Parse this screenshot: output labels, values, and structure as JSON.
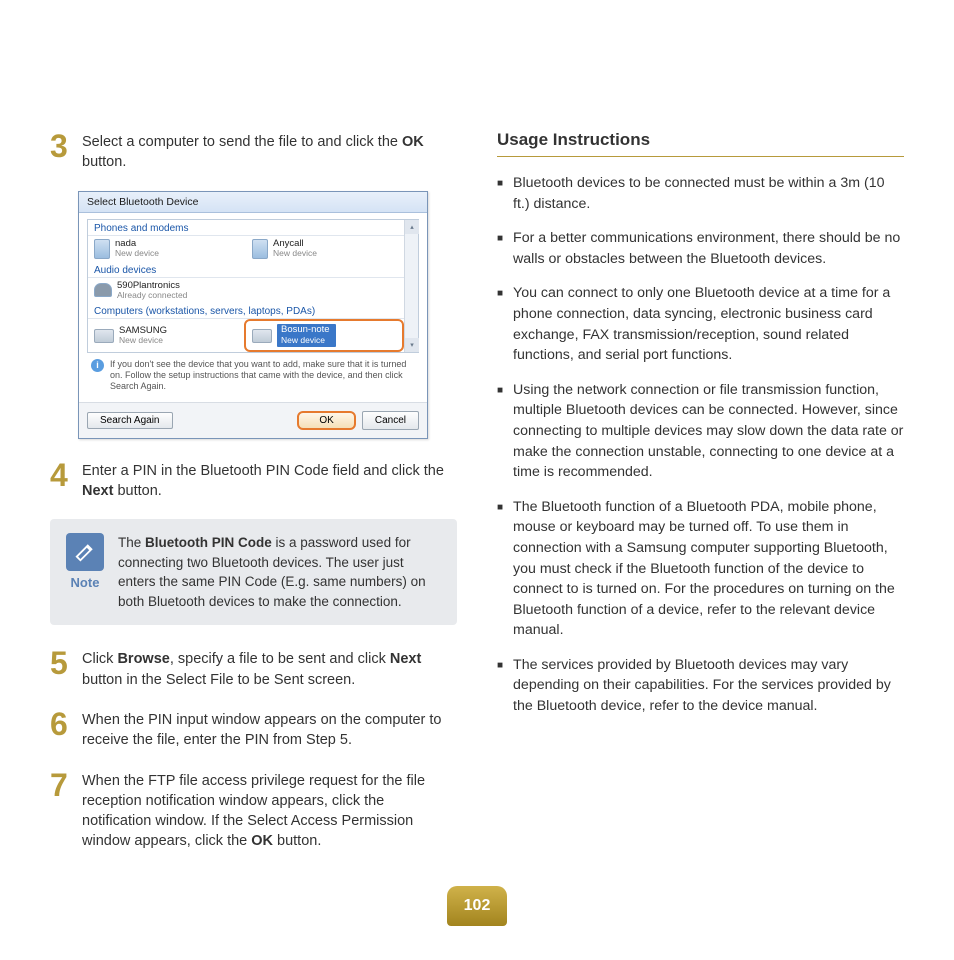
{
  "page_number": "102",
  "left": {
    "steps": [
      {
        "n": "3",
        "pre": "Select a computer to send the file to and click the ",
        "bold": "OK",
        "post": " button."
      },
      {
        "n": "4",
        "pre": "Enter a PIN in the Bluetooth PIN Code field and click the ",
        "bold": "Next",
        "post": " button."
      },
      {
        "n": "5",
        "pre": "Click ",
        "bold": "Browse",
        "mid": ", specify a file to be sent and click ",
        "bold2": "Next",
        "post": " button in the Select File to be Sent screen."
      },
      {
        "n": "6",
        "pre": "When the PIN input window appears on the computer to receive the file, enter the PIN from Step 5.",
        "bold": "",
        "post": ""
      },
      {
        "n": "7",
        "pre": "When the FTP file access privilege request for the file reception notification window appears, click the notification window. If the Select Access Permission window appears, click the ",
        "bold": "OK",
        "post": " button."
      }
    ],
    "note": {
      "label": "Note",
      "pre": "The ",
      "bold": "Bluetooth PIN Code",
      "post": " is a password used for connecting two Bluetooth devices. The user just enters the same PIN Code (E.g. same numbers) on both Bluetooth devices to make the connection."
    },
    "dialog": {
      "title": "Select Bluetooth Device",
      "cat_phones": "Phones and modems",
      "dev_nada": {
        "name": "nada",
        "sub": "New device"
      },
      "dev_anycall": {
        "name": "Anycall",
        "sub": "New device"
      },
      "cat_audio": "Audio devices",
      "dev_plan": {
        "name": "590Plantronics",
        "sub": "Already connected"
      },
      "cat_comp": "Computers (workstations, servers, laptops, PDAs)",
      "dev_samsung": {
        "name": "SAMSUNG",
        "sub": "New device"
      },
      "dev_bosun": {
        "name": "Bosun-note",
        "sub": "New device"
      },
      "info": "If you don't see the device that you want to add, make sure that it is turned on. Follow the setup instructions that came with the device, and then click Search Again.",
      "btn_search": "Search Again",
      "btn_ok": "OK",
      "btn_cancel": "Cancel"
    }
  },
  "right": {
    "title": "Usage Instructions",
    "bullets": [
      "Bluetooth devices to be connected must be within a 3m (10 ft.) distance.",
      "For a better communications environment, there should be no walls or obstacles between the Bluetooth devices.",
      "You can connect to only one Bluetooth device at a time for a phone connection, data syncing, electronic business card exchange, FAX transmission/reception, sound related functions, and serial port functions.",
      "Using the network connection or file transmission function, multiple Bluetooth devices can be connected. However, since connecting to multiple devices may slow down the data rate or make the connection unstable, connecting to one device at a time is recommended.",
      "The Bluetooth function of a Bluetooth PDA, mobile phone, mouse or keyboard may be turned off. To use them in connection with a Samsung computer supporting Bluetooth, you must check if the Bluetooth function of the device to connect to is turned on. For the procedures on turning on the Bluetooth function of a device, refer to the relevant device manual.",
      "The services provided by Bluetooth devices may vary depending on their capabilities. For the services provided by the Bluetooth device, refer to the device manual."
    ]
  }
}
